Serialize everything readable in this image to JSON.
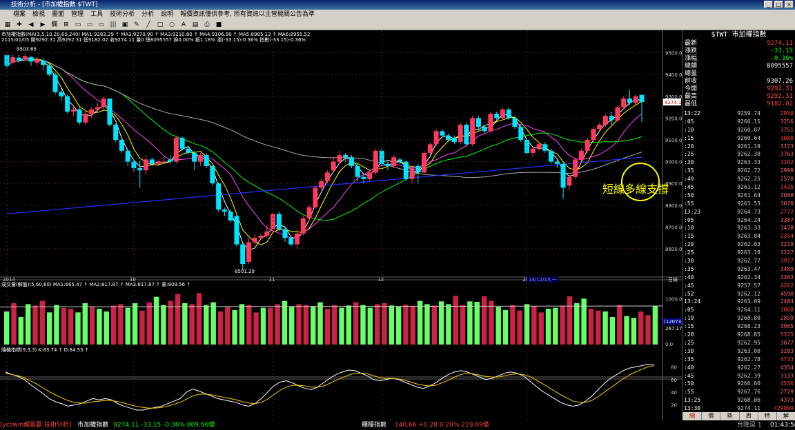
{
  "window": {
    "title": "技術分析 - [市加權指數 $TWT]"
  },
  "menu": [
    "檔案",
    "檢視",
    "畫面",
    "管理",
    "工具",
    "技術分析",
    "分析",
    "說明",
    "報價資訊僅供參考, 所有資訊以主管機關公告為準"
  ],
  "colors": {
    "up": "#ff3a5c",
    "down": "#00e5ff",
    "ma1": "#ffffff",
    "ma2": "#ffff00",
    "ma3": "#ff44ff",
    "ma4": "#00ff00",
    "ma5": "#aaaaaa",
    "ma240": "#2233ff",
    "volUp": "#cc2244",
    "volDown": "#66ff66",
    "annot": "#ffff00"
  },
  "chart": {
    "info1": "市加權指數(MA(3,5,10,20,60,240)  MA1:9283.29 ↑ MA2:9270.90 ↑ MA3:9210.60 ↑ MA4:9106.90 ↑ MA5:8985.13 ↑ MA6:8955.52",
    "info2": "2015/01/05 開9292.31 高9292.31 低9182.02 收9274.11 量0 總8095557 換0.00% 振1.18% 漲(-33.15)-0.36% 指數(-33.15)-0.36%",
    "y_labels": [
      "9500.0",
      "9400.0",
      "9300.0",
      "9200.0",
      "9100.0",
      "9000.0",
      "8900.0",
      "8800.0",
      "8700.0",
      "8600.0"
    ],
    "y_values": [
      9500,
      9400,
      9300,
      9200,
      9100,
      9000,
      8900,
      8800,
      8700,
      8600
    ],
    "x_labels": [
      "2014",
      "10",
      "11",
      "12",
      "2015"
    ],
    "x_index": [
      0,
      21,
      44,
      62,
      86
    ],
    "cursor_label": "14/12/15,一",
    "axis_mode": "日線",
    "high_label": "9503.65",
    "low_label": "8501.29",
    "price_tag": "9274.1",
    "annotation": "短線多線支撐"
  },
  "volume": {
    "info": "成交量(解盤)(5,60,60) MA1:665.47 ↑ MA2:817.87 ↑ MA3:817.87 ↑ 量:809.56 ↑",
    "y_labels": [
      "1000.0",
      "0.0"
    ],
    "tag1": "(12073)",
    "tag2": "267.17"
  },
  "kd": {
    "info": "隨機指標(9,3,3) K:83.74 ↑ D:84.53 ↑",
    "y_labels": [
      "80",
      "60",
      "40",
      "20"
    ]
  },
  "side": {
    "title": "$TWT 市加權指數",
    "quote": [
      {
        "k": "最新",
        "v": "9274.11",
        "c": "#ff4444"
      },
      {
        "k": "漲跌",
        "v": "-33.15",
        "c": "#00ff00"
      },
      {
        "k": "漲幅",
        "v": "-0.36%",
        "c": "#00ff00"
      },
      {
        "k": "總額",
        "v": "8095557",
        "c": "#ffffff"
      },
      {
        "k": "總量",
        "v": "",
        "c": "#ffffff"
      },
      {
        "k": "前收",
        "v": "9307.26",
        "c": "#ffffff"
      },
      {
        "k": "今開",
        "v": "9292.31",
        "c": "#ff4444"
      },
      {
        "k": "最高",
        "v": "9292.31",
        "c": "#ff4444"
      },
      {
        "k": "最低",
        "v": "9182.02",
        "c": "#ff4444"
      }
    ],
    "ticks": [
      {
        "t": "13:22",
        "p": "9259.74",
        "q": "2950"
      },
      {
        "t": ":05",
        "p": "9260.15",
        "q": "3256"
      },
      {
        "t": ":10",
        "p": "9260.07",
        "q": "3751"
      },
      {
        "t": ":15",
        "p": "9260.64",
        "q": "3080"
      },
      {
        "t": ":20",
        "p": "9261.19",
        "q": "3173"
      },
      {
        "t": ":25",
        "p": "9262.38",
        "q": "3763"
      },
      {
        "t": ":30",
        "p": "9263.33",
        "q": "3102"
      },
      {
        "t": ":35",
        "p": "9262.72",
        "q": "2999"
      },
      {
        "t": ":40",
        "p": "9262.25",
        "q": "2578"
      },
      {
        "t": ":45",
        "p": "9261.12",
        "q": "3435"
      },
      {
        "t": ":50",
        "p": "9261.64",
        "q": "3088"
      },
      {
        "t": ":55",
        "p": "9263.53",
        "q": "3070"
      },
      {
        "t": "13:23",
        "p": "9264.73",
        "q": "2772"
      },
      {
        "t": ":05",
        "p": "9264.24",
        "q": "3387"
      },
      {
        "t": ":10",
        "p": "9263.33",
        "q": "3428"
      },
      {
        "t": ":15",
        "p": "9263.04",
        "q": "2354"
      },
      {
        "t": ":20",
        "p": "9262.03",
        "q": "3219"
      },
      {
        "t": ":25",
        "p": "9263.18",
        "q": "3127"
      },
      {
        "t": ":30",
        "p": "9262.77",
        "q": "3977"
      },
      {
        "t": ":35",
        "p": "9263.47",
        "q": "3489"
      },
      {
        "t": ":40",
        "p": "9262.34",
        "q": "3303"
      },
      {
        "t": ":45",
        "p": "9257.57",
        "q": "4262"
      },
      {
        "t": ":52",
        "p": "9262.12",
        "q": "4590"
      },
      {
        "t": "13:24",
        "p": "9263.09",
        "q": "2484"
      },
      {
        "t": ":05",
        "p": "9264.11",
        "q": "3068"
      },
      {
        "t": ":10",
        "p": "9268.80",
        "q": "2859"
      },
      {
        "t": ":15",
        "p": "9268.23",
        "q": "3965"
      },
      {
        "t": ":20",
        "p": "9268.85",
        "q": "5125"
      },
      {
        "t": ":25",
        "p": "9262.95",
        "q": "3077"
      },
      {
        "t": ":30",
        "p": "9263.00",
        "q": "3283"
      },
      {
        "t": ":35",
        "p": "9262.78",
        "q": "4733"
      },
      {
        "t": ":40",
        "p": "9262.27",
        "q": "4354"
      },
      {
        "t": ":45",
        "p": "9262.39",
        "q": "3133"
      },
      {
        "t": ":50",
        "p": "9266.60",
        "q": "4536"
      },
      {
        "t": ":55",
        "p": "9267.76",
        "q": "2729"
      },
      {
        "t": "13:25",
        "p": "9268.06",
        "q": "4373"
      },
      {
        "t": "13:30",
        "p": "9274.11",
        "q": "429099"
      },
      {
        "t": "14:30",
        "p": "9274.11",
        "q": "20416"
      }
    ],
    "tabs": [
      "細",
      "價",
      "勢",
      "周",
      "特",
      "解"
    ]
  },
  "status": {
    "brand": "[ycswin越是贏 技術分析]",
    "left": "市加權指數",
    "left_val": "9274.11 -33.15 -0.36% 809.56億",
    "mid": "櫃檯指數",
    "mid_val": "140.66 +0.28 0.20% 219.89億",
    "conn": "台隆逗 1",
    "time": "01:43:58"
  },
  "candles": [
    [
      9490,
      9440,
      9490,
      9430
    ],
    [
      9455,
      9480,
      9495,
      9450
    ],
    [
      9478,
      9465,
      9490,
      9455
    ],
    [
      9470,
      9485,
      9495,
      9460
    ],
    [
      9480,
      9460,
      9485,
      9440
    ],
    [
      9455,
      9470,
      9480,
      9440
    ],
    [
      9465,
      9445,
      9475,
      9420
    ],
    [
      9440,
      9400,
      9450,
      9390
    ],
    [
      9400,
      9320,
      9410,
      9310
    ],
    [
      9320,
      9300,
      9340,
      9280
    ],
    [
      9300,
      9230,
      9310,
      9220
    ],
    [
      9230,
      9240,
      9260,
      9210
    ],
    [
      9240,
      9180,
      9250,
      9170
    ],
    [
      9180,
      9220,
      9235,
      9170
    ],
    [
      9220,
      9240,
      9250,
      9200
    ],
    [
      9240,
      9250,
      9270,
      9230
    ],
    [
      9250,
      9290,
      9300,
      9240
    ],
    [
      9290,
      9170,
      9290,
      9160
    ],
    [
      9170,
      9100,
      9175,
      9090
    ],
    [
      9100,
      9050,
      9110,
      9040
    ],
    [
      9050,
      9000,
      9060,
      8980
    ],
    [
      9000,
      8970,
      9010,
      8950
    ],
    [
      8970,
      8960,
      9005,
      8880
    ],
    [
      8960,
      9010,
      9030,
      8940
    ],
    [
      9010,
      8990,
      9020,
      8980
    ],
    [
      8990,
      9000,
      9010,
      8980
    ],
    [
      9000,
      9000,
      9020,
      8990
    ],
    [
      9010,
      9000,
      9030,
      8990
    ],
    [
      9000,
      9110,
      9120,
      8990
    ],
    [
      9110,
      9060,
      9115,
      9050
    ],
    [
      9060,
      9040,
      9070,
      9030
    ],
    [
      9040,
      9000,
      9050,
      8960
    ],
    [
      9000,
      9030,
      9040,
      8980
    ],
    [
      9030,
      8980,
      9040,
      8970
    ],
    [
      8980,
      8900,
      8985,
      8890
    ],
    [
      8900,
      8780,
      8905,
      8770
    ],
    [
      8780,
      8770,
      8790,
      8750
    ],
    [
      8770,
      8730,
      8780,
      8720
    ],
    [
      8750,
      8620,
      8755,
      8610
    ],
    [
      8620,
      8530,
      8630,
      8500
    ],
    [
      8540,
      8630,
      8650,
      8530
    ],
    [
      8630,
      8650,
      8665,
      8620
    ],
    [
      8650,
      8660,
      8670,
      8640
    ],
    [
      8660,
      8680,
      8710,
      8650
    ],
    [
      8690,
      8760,
      8770,
      8680
    ],
    [
      8760,
      8690,
      8770,
      8680
    ],
    [
      8690,
      8650,
      8700,
      8630
    ],
    [
      8650,
      8620,
      8660,
      8610
    ],
    [
      8620,
      8670,
      8690,
      8600
    ],
    [
      8670,
      8740,
      8750,
      8660
    ],
    [
      8740,
      8790,
      8800,
      8730
    ],
    [
      8790,
      8880,
      8890,
      8780
    ],
    [
      8880,
      8910,
      8920,
      8870
    ],
    [
      8910,
      8950,
      8960,
      8900
    ],
    [
      8960,
      9000,
      9020,
      8950
    ],
    [
      9000,
      9030,
      9050,
      8990
    ],
    [
      9030,
      9020,
      9040,
      9000
    ],
    [
      9020,
      8980,
      9030,
      8970
    ],
    [
      8980,
      8930,
      8990,
      8910
    ],
    [
      8930,
      8920,
      8940,
      8900
    ],
    [
      8920,
      8950,
      8960,
      8910
    ],
    [
      8950,
      9050,
      9060,
      8940
    ],
    [
      9050,
      8990,
      9060,
      8980
    ],
    [
      8990,
      8980,
      9000,
      8960
    ],
    [
      8980,
      9020,
      9030,
      8970
    ],
    [
      9010,
      9000,
      9020,
      8990
    ],
    [
      9000,
      8920,
      9005,
      8910
    ],
    [
      8920,
      8970,
      8980,
      8900
    ],
    [
      8980,
      8950,
      8990,
      8900
    ],
    [
      8950,
      9040,
      9050,
      8940
    ],
    [
      9040,
      9080,
      9090,
      9030
    ],
    [
      9080,
      9140,
      9150,
      9070
    ],
    [
      9140,
      9120,
      9150,
      9110
    ],
    [
      9120,
      9100,
      9130,
      9090
    ],
    [
      9110,
      9090,
      9120,
      9080
    ],
    [
      9090,
      9170,
      9180,
      9080
    ],
    [
      9170,
      9080,
      9180,
      9070
    ],
    [
      9080,
      9200,
      9210,
      9070
    ],
    [
      9200,
      9160,
      9210,
      9150
    ],
    [
      9160,
      9140,
      9170,
      9130
    ],
    [
      9140,
      9220,
      9230,
      9130
    ],
    [
      9220,
      9200,
      9230,
      9190
    ],
    [
      9200,
      9240,
      9250,
      9190
    ],
    [
      9240,
      9200,
      9250,
      9190
    ],
    [
      9200,
      9160,
      9210,
      9150
    ],
    [
      9160,
      9100,
      9170,
      9090
    ],
    [
      9100,
      9040,
      9110,
      9030
    ],
    [
      9040,
      9060,
      9070,
      9020
    ],
    [
      9060,
      9080,
      9090,
      9050
    ],
    [
      9080,
      9050,
      9090,
      9040
    ],
    [
      9050,
      9000,
      9060,
      8990
    ],
    [
      9000,
      8990,
      9010,
      8970
    ],
    [
      8990,
      8880,
      9000,
      8830
    ],
    [
      8890,
      8930,
      8940,
      8870
    ],
    [
      8930,
      9010,
      9020,
      8920
    ],
    [
      9010,
      9050,
      9060,
      9000
    ],
    [
      9050,
      9100,
      9110,
      9040
    ],
    [
      9100,
      9150,
      9160,
      9090
    ],
    [
      9150,
      9170,
      9180,
      9140
    ],
    [
      9170,
      9210,
      9220,
      9160
    ],
    [
      9210,
      9190,
      9230,
      9170
    ],
    [
      9190,
      9250,
      9260,
      9180
    ],
    [
      9250,
      9290,
      9300,
      9240
    ],
    [
      9290,
      9270,
      9330,
      9260
    ],
    [
      9270,
      9300,
      9310,
      9260
    ],
    [
      9307,
      9274,
      9292,
      9182
    ]
  ],
  "volumes": [
    0.72,
    0.9,
    0.6,
    0.88,
    0.85,
    0.95,
    0.7,
    0.86,
    0.8,
    0.78,
    0.7,
    0.9,
    0.82,
    0.78,
    0.72,
    0.85,
    0.88,
    0.8,
    0.9,
    0.74,
    0.92,
    1.04,
    0.86,
    0.95,
    1.1,
    0.9,
    0.88,
    1.12,
    0.86,
    0.92,
    0.72,
    0.82,
    0.75,
    0.88,
    0.86,
    0.7,
    0.8,
    0.8,
    0.88,
    0.95,
    0.82,
    0.88,
    0.86,
    0.83,
    0.92,
    0.78,
    0.86,
    0.8,
    0.85,
    0.92,
    0.86,
    0.8,
    0.88,
    0.9,
    0.85,
    0.82,
    0.87,
    0.83,
    0.95,
    0.88,
    0.85,
    0.94,
    0.88,
    1.06,
    0.86,
    0.94,
    0.93,
    1.05,
    0.95,
    0.82,
    0.75,
    0.86,
    0.74,
    0.88,
    0.84,
    0.7,
    0.78,
    0.8,
    0.85,
    1.05,
    0.9,
    1.0,
    0.78,
    0.74,
    0.72,
    0.6,
    0.86,
    0.62,
    0.58,
    0.72,
    0.64,
    0.84
  ],
  "k_values": [
    72,
    68,
    65,
    60,
    52,
    45,
    38,
    30,
    25,
    22,
    18,
    20,
    22,
    26,
    30,
    28,
    30,
    28,
    22,
    18,
    15,
    12,
    12,
    14,
    16,
    18,
    22,
    26,
    30,
    40,
    45,
    42,
    38,
    34,
    30,
    28,
    26,
    24,
    20,
    18,
    22,
    30,
    40,
    50,
    56,
    58,
    55,
    50,
    46,
    44,
    48,
    55,
    62,
    68,
    72,
    75,
    74,
    70,
    66,
    60,
    58,
    60,
    62,
    60,
    56,
    52,
    48,
    46,
    50,
    55,
    62,
    68,
    72,
    74,
    72,
    68,
    64,
    60,
    62,
    66,
    70,
    72,
    70,
    66,
    58,
    50,
    42,
    36,
    30,
    24,
    20,
    18,
    20,
    26,
    34,
    44,
    54,
    62,
    68,
    74,
    78,
    80,
    82,
    84,
    83
  ],
  "d_values": [
    70,
    68,
    66,
    63,
    58,
    53,
    47,
    41,
    36,
    31,
    27,
    24,
    23,
    23,
    25,
    26,
    27,
    27,
    25,
    23,
    20,
    18,
    16,
    15,
    15,
    16,
    18,
    21,
    24,
    29,
    34,
    37,
    37,
    36,
    34,
    32,
    30,
    28,
    25,
    23,
    22,
    24,
    29,
    36,
    43,
    48,
    51,
    51,
    50,
    48,
    48,
    50,
    54,
    59,
    63,
    67,
    70,
    70,
    69,
    66,
    63,
    62,
    62,
    61,
    59,
    56,
    53,
    51,
    50,
    51,
    55,
    59,
    64,
    68,
    70,
    69,
    67,
    65,
    64,
    64,
    66,
    68,
    69,
    68,
    65,
    60,
    54,
    48,
    42,
    36,
    31,
    26,
    24,
    24,
    27,
    33,
    40,
    47,
    54,
    61,
    67,
    72,
    76,
    80,
    82
  ]
}
